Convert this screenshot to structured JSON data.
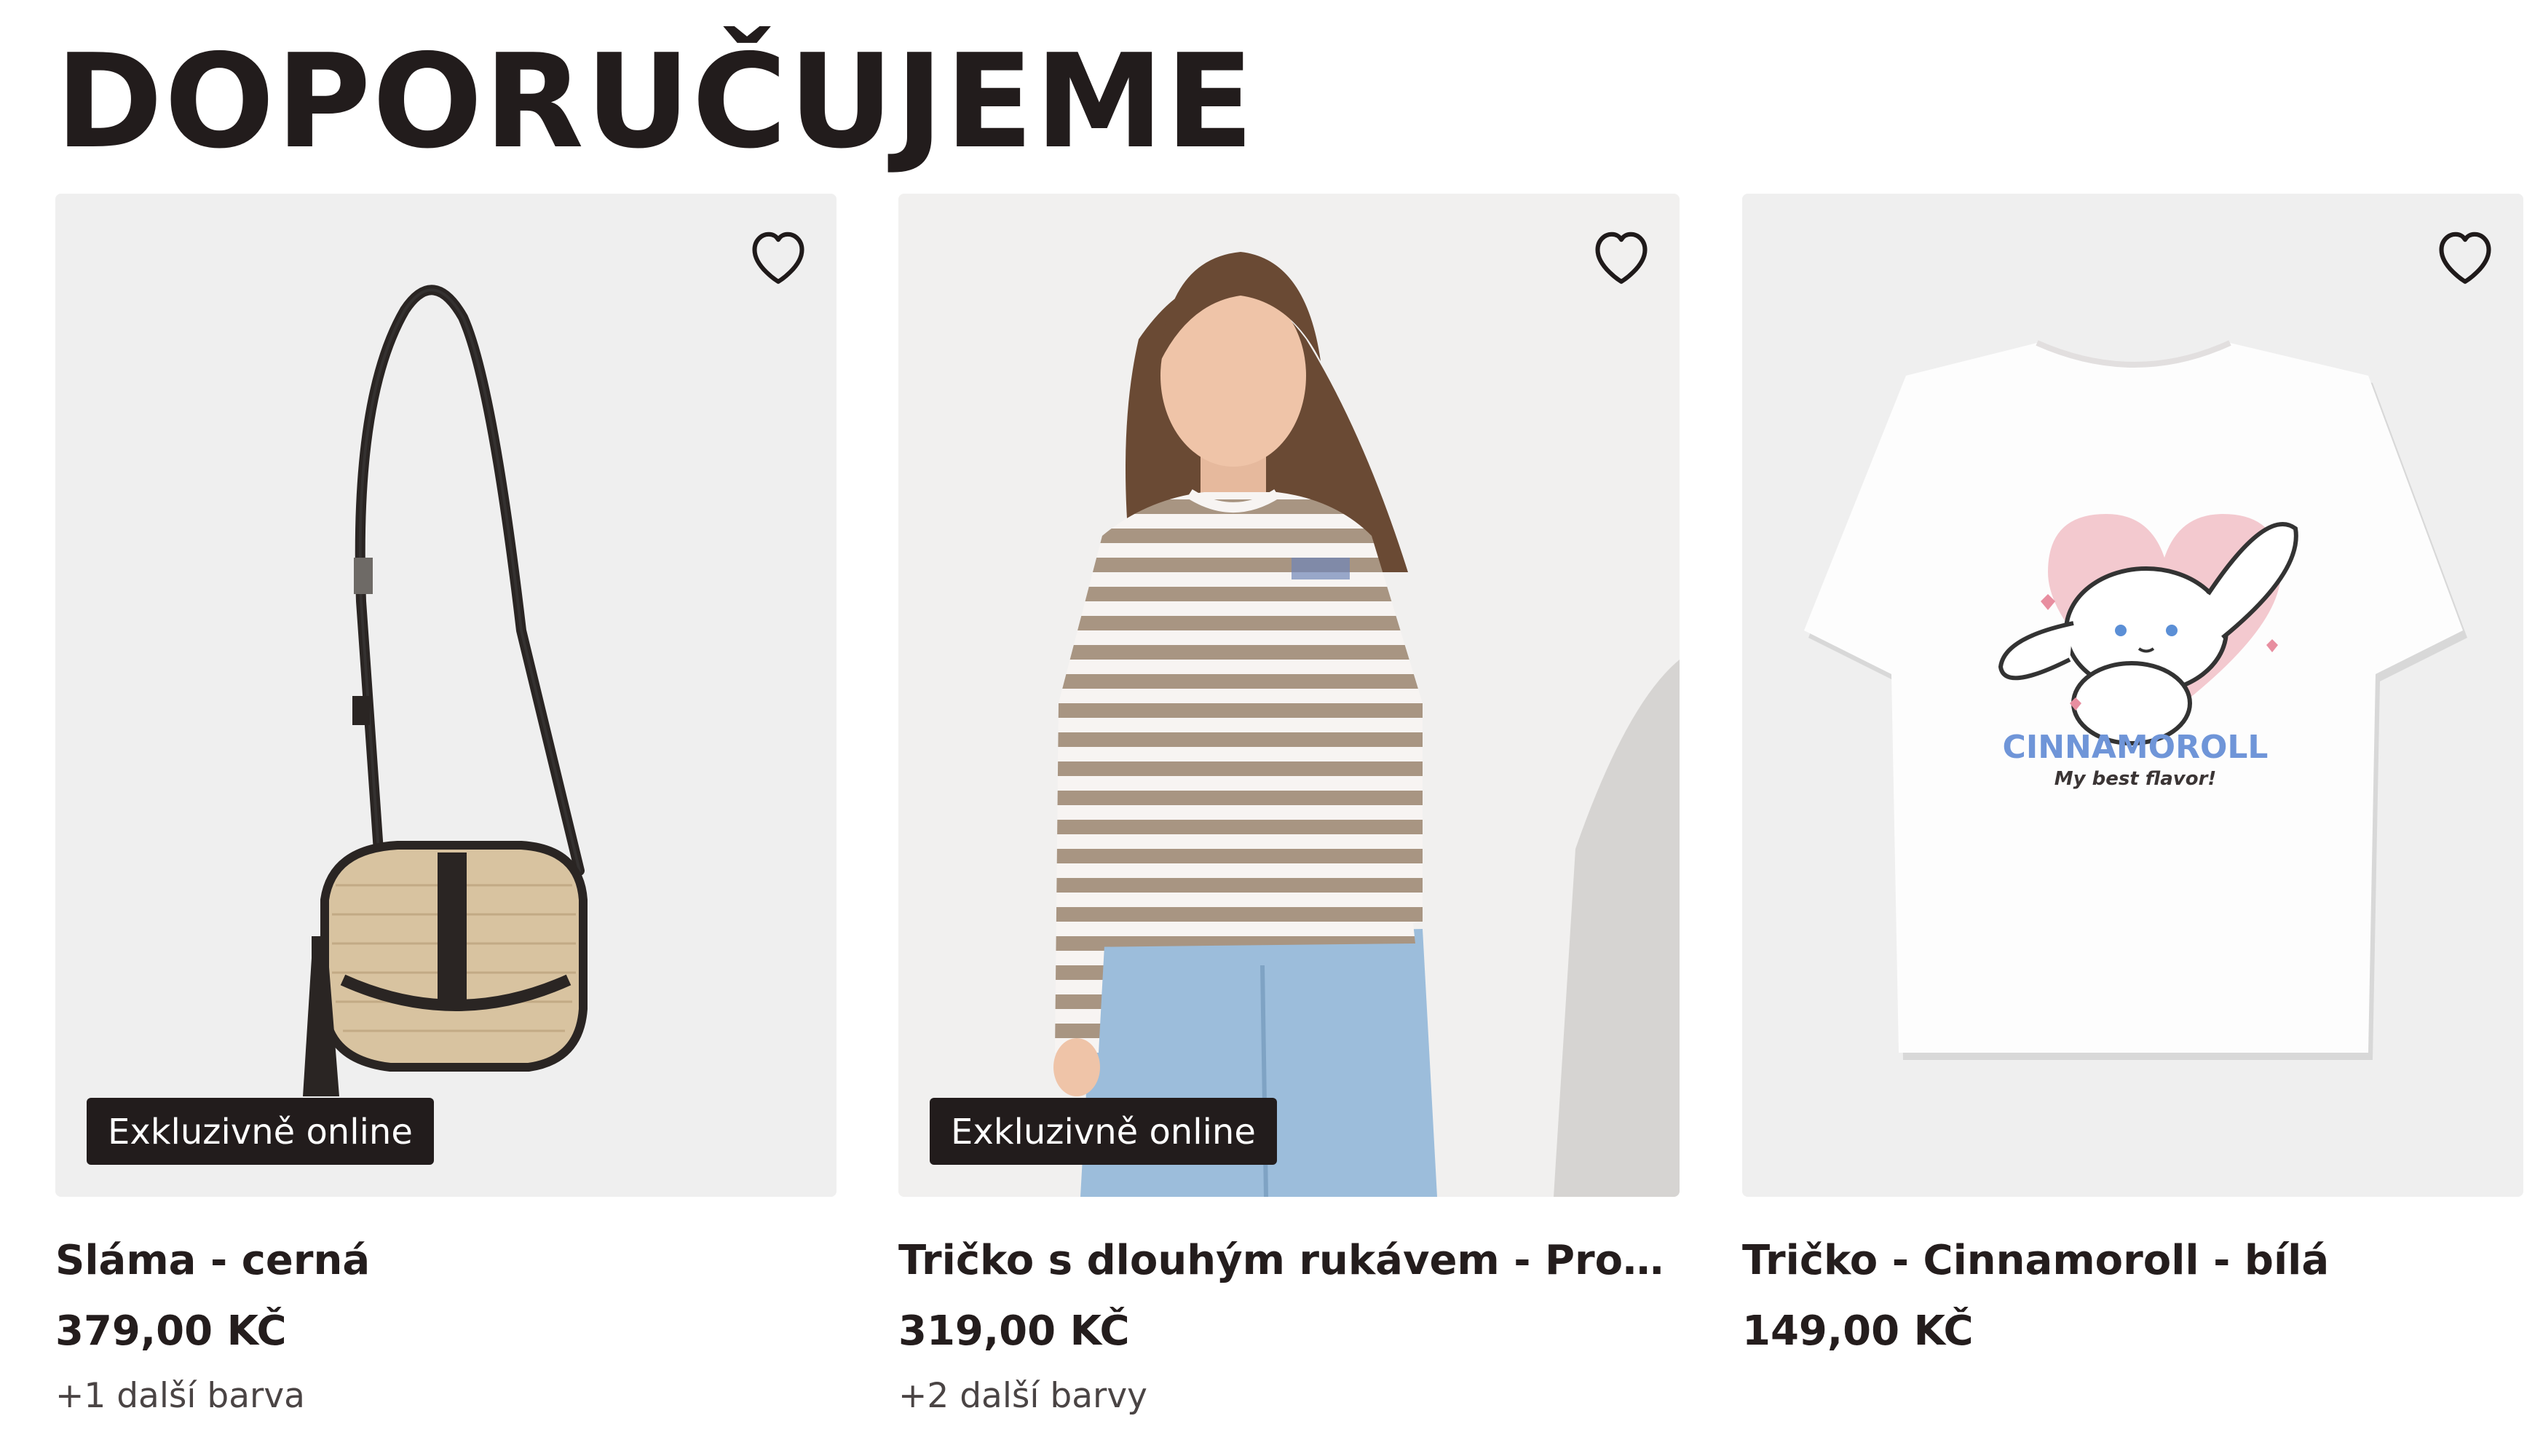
{
  "section": {
    "title": "DOPORUČUJEME"
  },
  "colors": {
    "text": "#221c1c",
    "card_bg": "#efefef",
    "badge_bg": "#221c1c",
    "badge_text": "#ffffff"
  },
  "products": [
    {
      "name": "Sláma - cerná",
      "price": "379,00 KČ",
      "badge": "Exkluzivně online",
      "colors_note": "+1 další barva",
      "image": "crossbody-straw-bag",
      "wishlist_icon": "heart-outline-icon"
    },
    {
      "name": "Tričko s dlouhým rukávem - Proužky - ...",
      "price": "319,00 KČ",
      "badge": "Exkluzivně online",
      "colors_note": "+2 další barvy",
      "image": "striped-long-sleeve-tee-model",
      "wishlist_icon": "heart-outline-icon"
    },
    {
      "name": "Tričko - Cinnamoroll - bílá",
      "price": "149,00 KČ",
      "colors_note": "",
      "image": "white-tshirt-cinnamoroll-print",
      "print_title": "CINNAMOROLL",
      "print_subtitle": "My best flavor!",
      "wishlist_icon": "heart-outline-icon"
    }
  ]
}
